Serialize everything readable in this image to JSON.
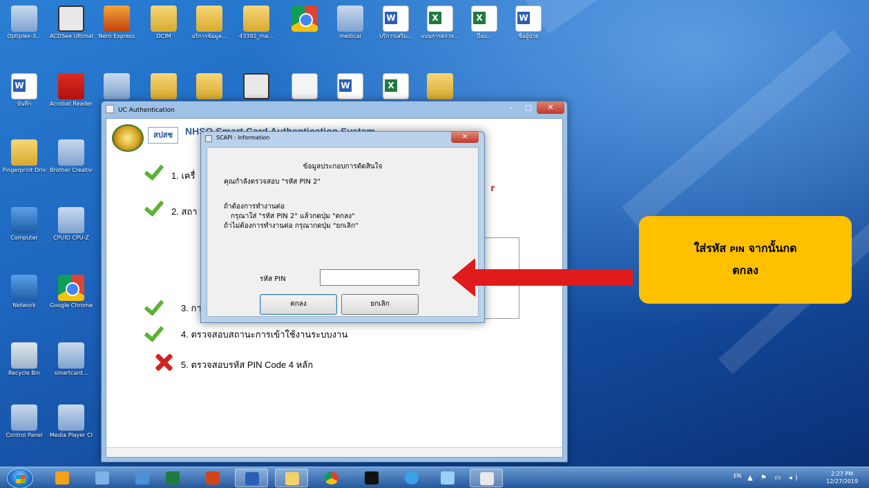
{
  "desktop": {
    "icons": [
      {
        "label": "Optiplex-3...",
        "glyph": "generic"
      },
      {
        "label": "ACDSee Ultimate...",
        "glyph": "camera"
      },
      {
        "label": "Nero Express",
        "glyph": "fire"
      },
      {
        "label": "DCIM",
        "glyph": "folder"
      },
      {
        "label": "บริการข้อมูล...",
        "glyph": "folder"
      },
      {
        "label": "43392_ma...",
        "glyph": "folder"
      },
      {
        "label": "",
        "glyph": "chrome"
      },
      {
        "label": "medical",
        "glyph": "generic"
      },
      {
        "label": "บริการเสริม...",
        "glyph": "word"
      },
      {
        "label": "แบบการตรวจ...",
        "glyph": "excel"
      },
      {
        "label": "ปีงบ...",
        "glyph": "excel"
      },
      {
        "label": "ชื่อผู้ป่วย",
        "glyph": "word"
      },
      {
        "label": "บันทึก",
        "glyph": "word"
      },
      {
        "label": "Acrobat Reader DC",
        "glyph": "pdf"
      },
      {
        "label": "",
        "glyph": "generic"
      },
      {
        "label": "",
        "glyph": "folder"
      },
      {
        "label": "",
        "glyph": "folder"
      },
      {
        "label": "",
        "glyph": "camera"
      },
      {
        "label": "",
        "glyph": "doc"
      },
      {
        "label": "",
        "glyph": "word"
      },
      {
        "label": "",
        "glyph": "excel"
      },
      {
        "label": "",
        "glyph": "folder"
      },
      {
        "label": "Fingerprint Driver",
        "glyph": "folder"
      },
      {
        "label": "Brother Creative...",
        "glyph": "generic"
      },
      {
        "label": "Computer",
        "glyph": "pc"
      },
      {
        "label": "CPUID CPU-Z",
        "glyph": "generic"
      },
      {
        "label": "Network",
        "glyph": "pc"
      },
      {
        "label": "Google Chrome",
        "glyph": "chrome"
      },
      {
        "label": "Recycle Bin",
        "glyph": "bin"
      },
      {
        "label": "smartcard...",
        "glyph": "generic"
      },
      {
        "label": "Control Panel",
        "glyph": "generic"
      },
      {
        "label": "Media Player Classic",
        "glyph": "generic"
      }
    ]
  },
  "main_window": {
    "title": "UC Authentication",
    "min": "–",
    "max": "□",
    "close": "✕",
    "logo_text": "สปสช",
    "system_title": "NHSO Smart Card Authentication System",
    "steps": [
      {
        "text": "1. เครื่",
        "status": "ok"
      },
      {
        "text": "2. สถา",
        "status": "ok"
      },
      {
        "text": "3. กา",
        "status": "ok"
      },
      {
        "text": "4. ตรวจสอบสถานะการเข้าใช้งานระบบงาน",
        "status": "ok"
      },
      {
        "text": "5. ตรวจสอบรหัส PIN Code 4 หลัก",
        "status": "fail"
      }
    ],
    "side_text": "r"
  },
  "dialog": {
    "title": "SCAPI : Information",
    "close": "✕",
    "heading": "ข้อมูลประกอบการตัดสินใจ",
    "line1": "คุณกำลังตรวจสอบ \"รหัส PIN 2\"",
    "line2": "ถ้าต้องการทำงานต่อ",
    "line3": "กรุณาใส่ \"รหัส PIN 2\" แล้วกดปุ่ม \"ตกลง\"",
    "line4": "ถ้าไม่ต้องการทำงานต่อ กรุณากดปุ่ม \"ยกเลิก\"",
    "pin_label": "รหัส PIN",
    "pin_value": "",
    "ok_label": "ตกลง",
    "cancel_label": "ยกเลิก"
  },
  "annotation": {
    "line1_pre": "ใส่รหัส ",
    "line1_pin": "PIN",
    "line1_post": " จากนั้นกด",
    "line2": "ตกลง",
    "arrow_color": "#e01b1b",
    "callout_color": "#ffc000"
  },
  "taskbar": {
    "apps": [
      "ie-explorer",
      "media",
      "windows",
      "excel",
      "powerpoint",
      "word",
      "folder",
      "chrome",
      "cmd",
      "ie",
      "tools",
      "uc-auth"
    ],
    "lang": "EN",
    "time": "2:27 PM",
    "date": "12/27/2019"
  }
}
